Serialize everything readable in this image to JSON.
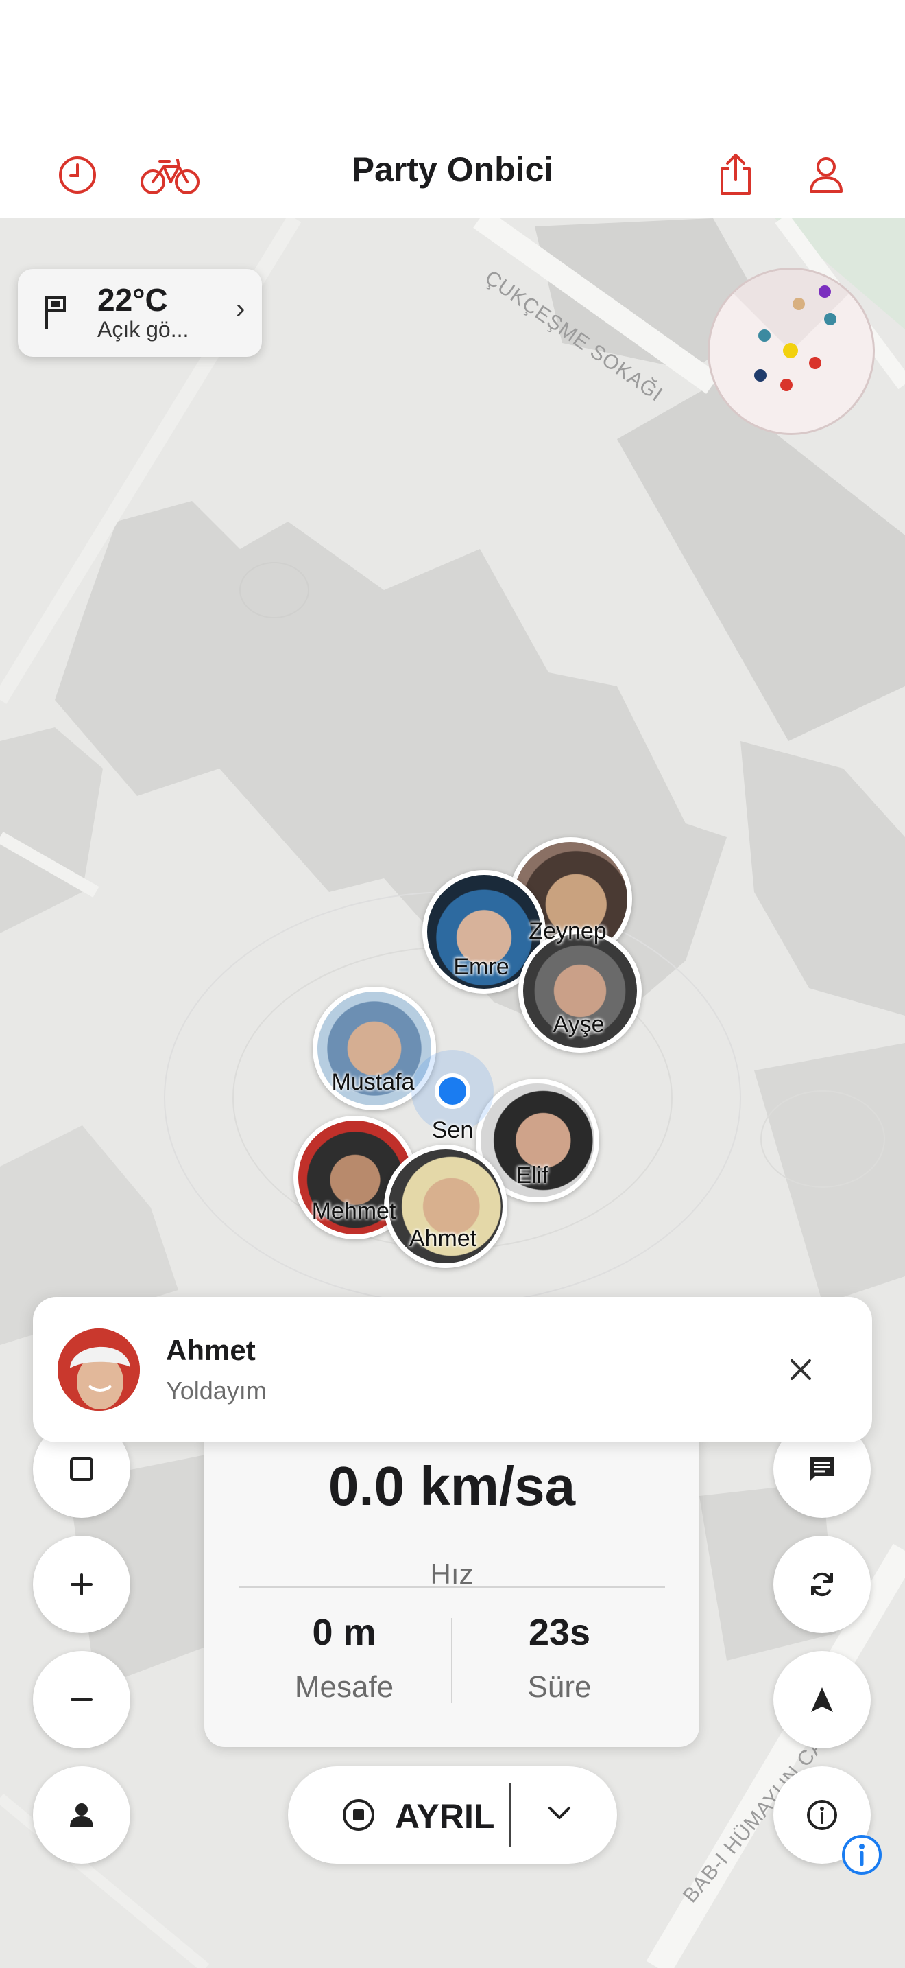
{
  "header": {
    "title": "Party Onbici",
    "icons": [
      "clock-icon",
      "bicycle-icon",
      "share-icon",
      "profile-icon"
    ],
    "accent_color": "#d9342b"
  },
  "map": {
    "street_labels": [
      "ÇUKÇEŞME SOKAĞI",
      "BAB-I HÜMAYUN CADDESİ"
    ]
  },
  "weather": {
    "temperature": "22°C",
    "condition": "Açık gö..."
  },
  "riders": [
    {
      "name": "Zeynep"
    },
    {
      "name": "Emre"
    },
    {
      "name": "Ayşe"
    },
    {
      "name": "Mustafa"
    },
    {
      "name": "Elif"
    },
    {
      "name": "Mehmet"
    },
    {
      "name": "Ahmet"
    }
  ],
  "me": {
    "label": "Sen",
    "color": "#1a7cf1"
  },
  "toast": {
    "name": "Ahmet",
    "message": "Yoldayım"
  },
  "stats": {
    "speed": "0.0 km/sa",
    "speed_label": "Hız",
    "distance": "0 m",
    "distance_label": "Mesafe",
    "duration": "23s",
    "duration_label": "Süre"
  },
  "leave": {
    "label": "AYRIL"
  }
}
